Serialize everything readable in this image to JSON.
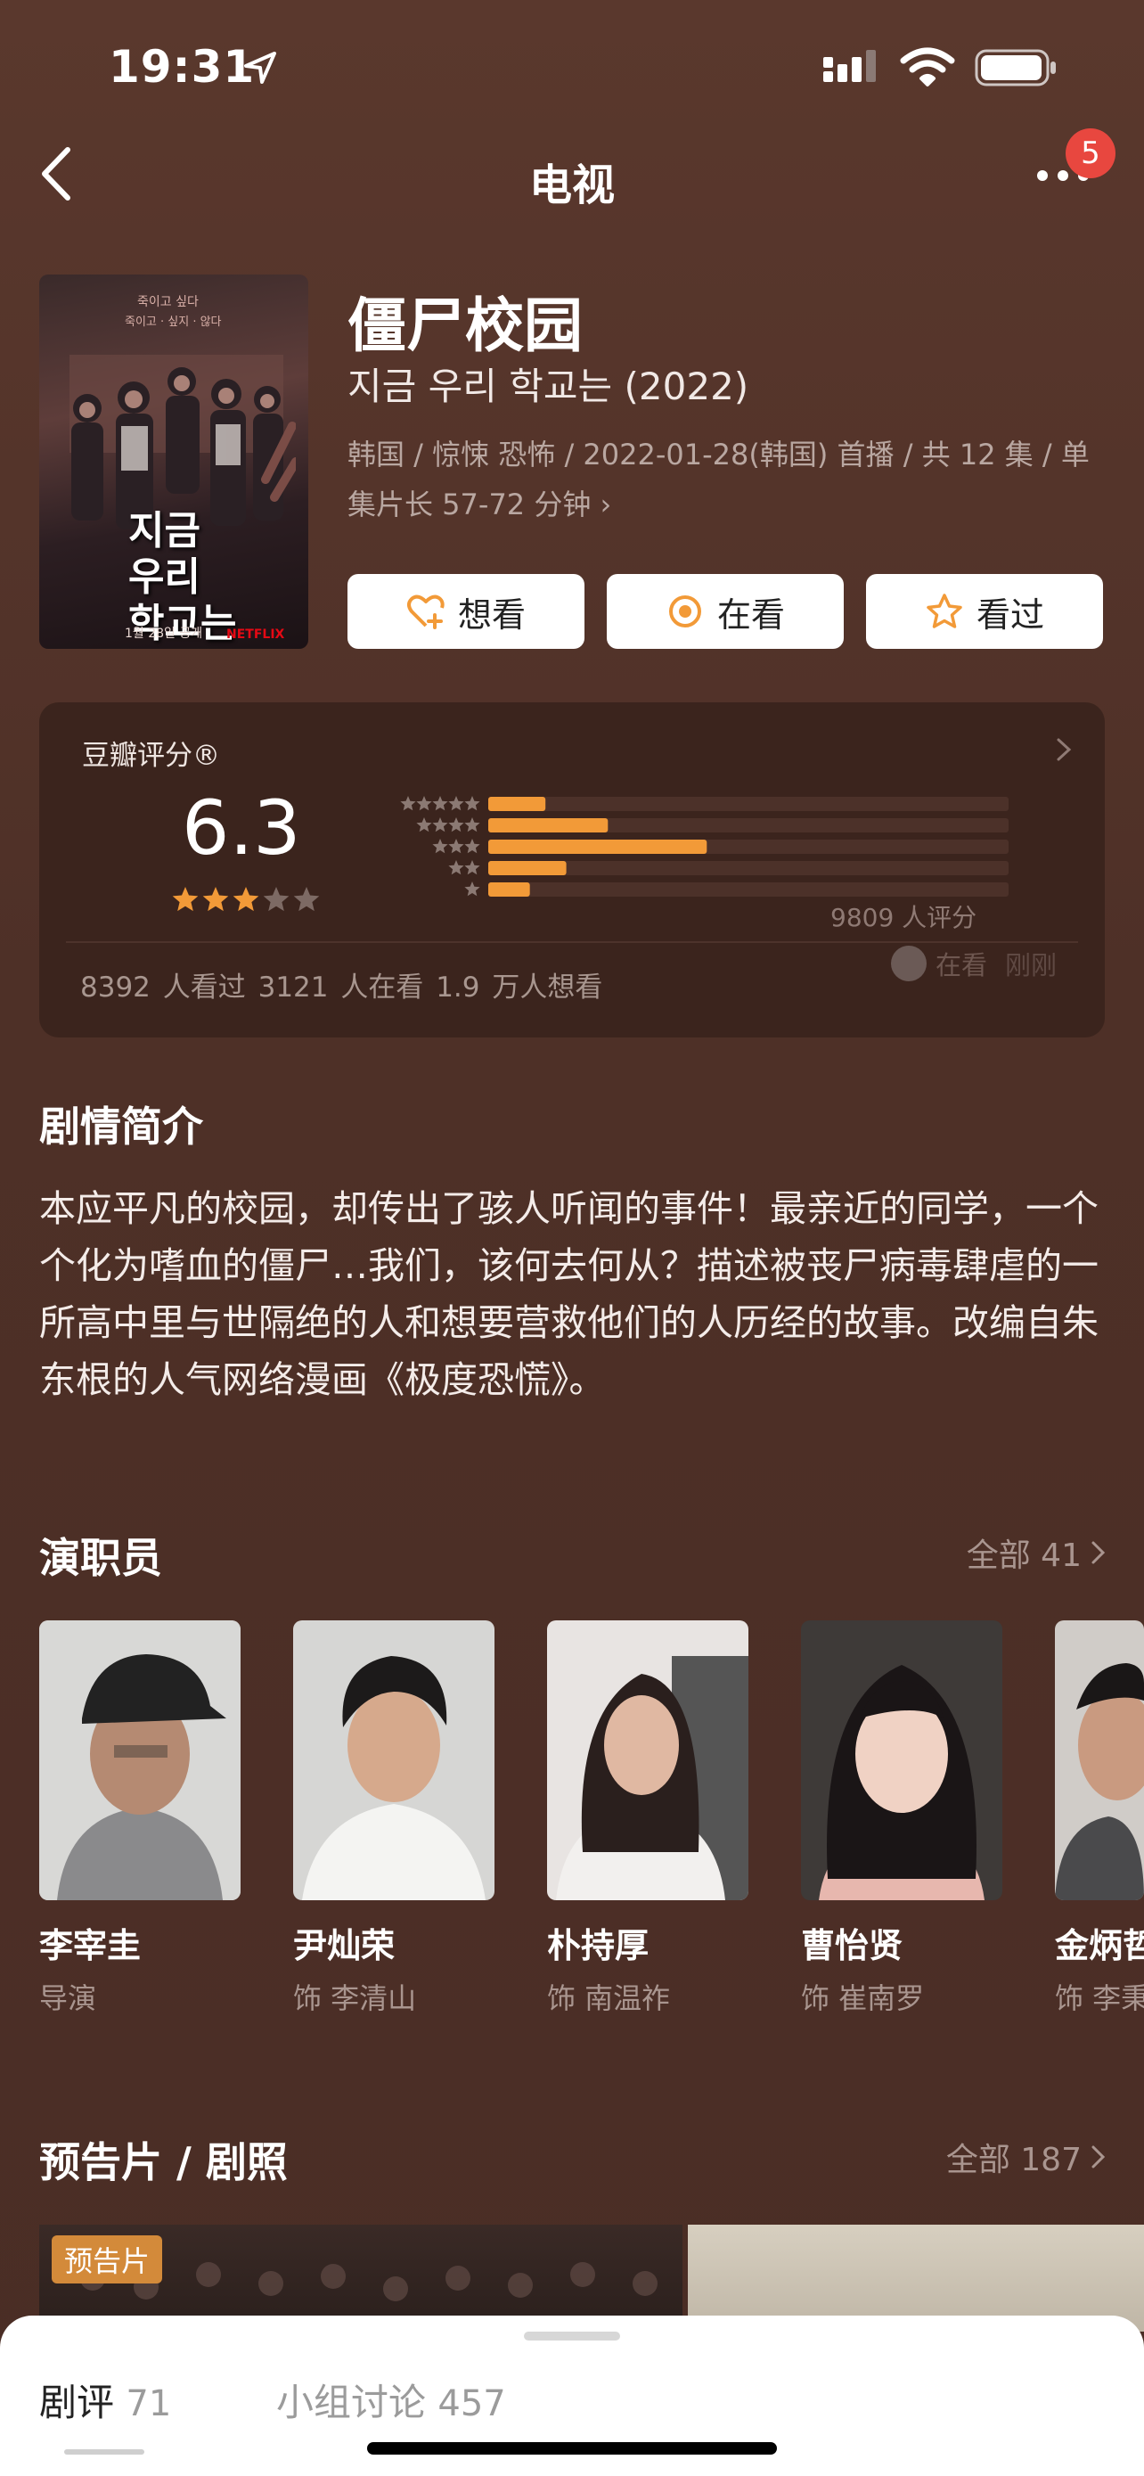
{
  "status_bar": {
    "time": "19:31"
  },
  "nav": {
    "title": "电视",
    "badge": "5"
  },
  "poster": {
    "top_text": "죽이고 싶다",
    "subtitle_text": "죽이고 · 싶지 · 않다",
    "title_line1": "지금",
    "title_line2": "우리",
    "title_line3": "학교는",
    "footer": "1월 28일 공개",
    "brand": "NETFLIX"
  },
  "info": {
    "title": "僵尸校园",
    "original_title": "지금 우리 학교는 (2022)",
    "meta": "韩国 / 惊悚 恐怖 / 2022-01-28(韩国) 首播 / 共 12 集 / 单集片长 57-72 分钟 ›"
  },
  "actions": [
    {
      "label": "想看",
      "icon": "heart-plus-icon"
    },
    {
      "label": "在看",
      "icon": "target-icon"
    },
    {
      "label": "看过",
      "icon": "star-outline-icon"
    }
  ],
  "rating": {
    "label": "豆瓣评分®",
    "score": "6.3",
    "stars": 3,
    "distribution": [
      0.11,
      0.23,
      0.42,
      0.15,
      0.08
    ],
    "count": "9809 人评分",
    "stats": "8392 人看过   3121 人在看   1.9 万人想看",
    "watching_label": "在看",
    "watching_time": "刚刚",
    "accent": "#f29a38"
  },
  "synopsis": {
    "title": "剧情简介",
    "text": "本应平凡的校园，却传出了骇人听闻的事件！最亲近的同学，一个个化为嗜血的僵尸…我们，该何去何从？描述被丧尸病毒肆虐的一所高中里与世隔绝的人和想要营救他们的人历经的故事。改编自朱东根的人气网络漫画《极度恐慌》。"
  },
  "cast": {
    "title": "演职员",
    "more": "全部 41",
    "people": [
      {
        "name": "李宰圭",
        "role": "导演"
      },
      {
        "name": "尹灿荣",
        "role": "饰 李清山"
      },
      {
        "name": "朴持厚",
        "role": "饰 南温祚"
      },
      {
        "name": "曹怡贤",
        "role": "饰 崔南罗"
      },
      {
        "name": "金炳哲",
        "role": "饰 李秉"
      }
    ]
  },
  "media": {
    "title": "预告片 / 剧照",
    "more": "全部 187",
    "tag": "预告片"
  },
  "sheet": {
    "tab1_label": "剧评",
    "tab1_count": "71",
    "tab2_label": "小组讨论",
    "tab2_count": "457"
  }
}
